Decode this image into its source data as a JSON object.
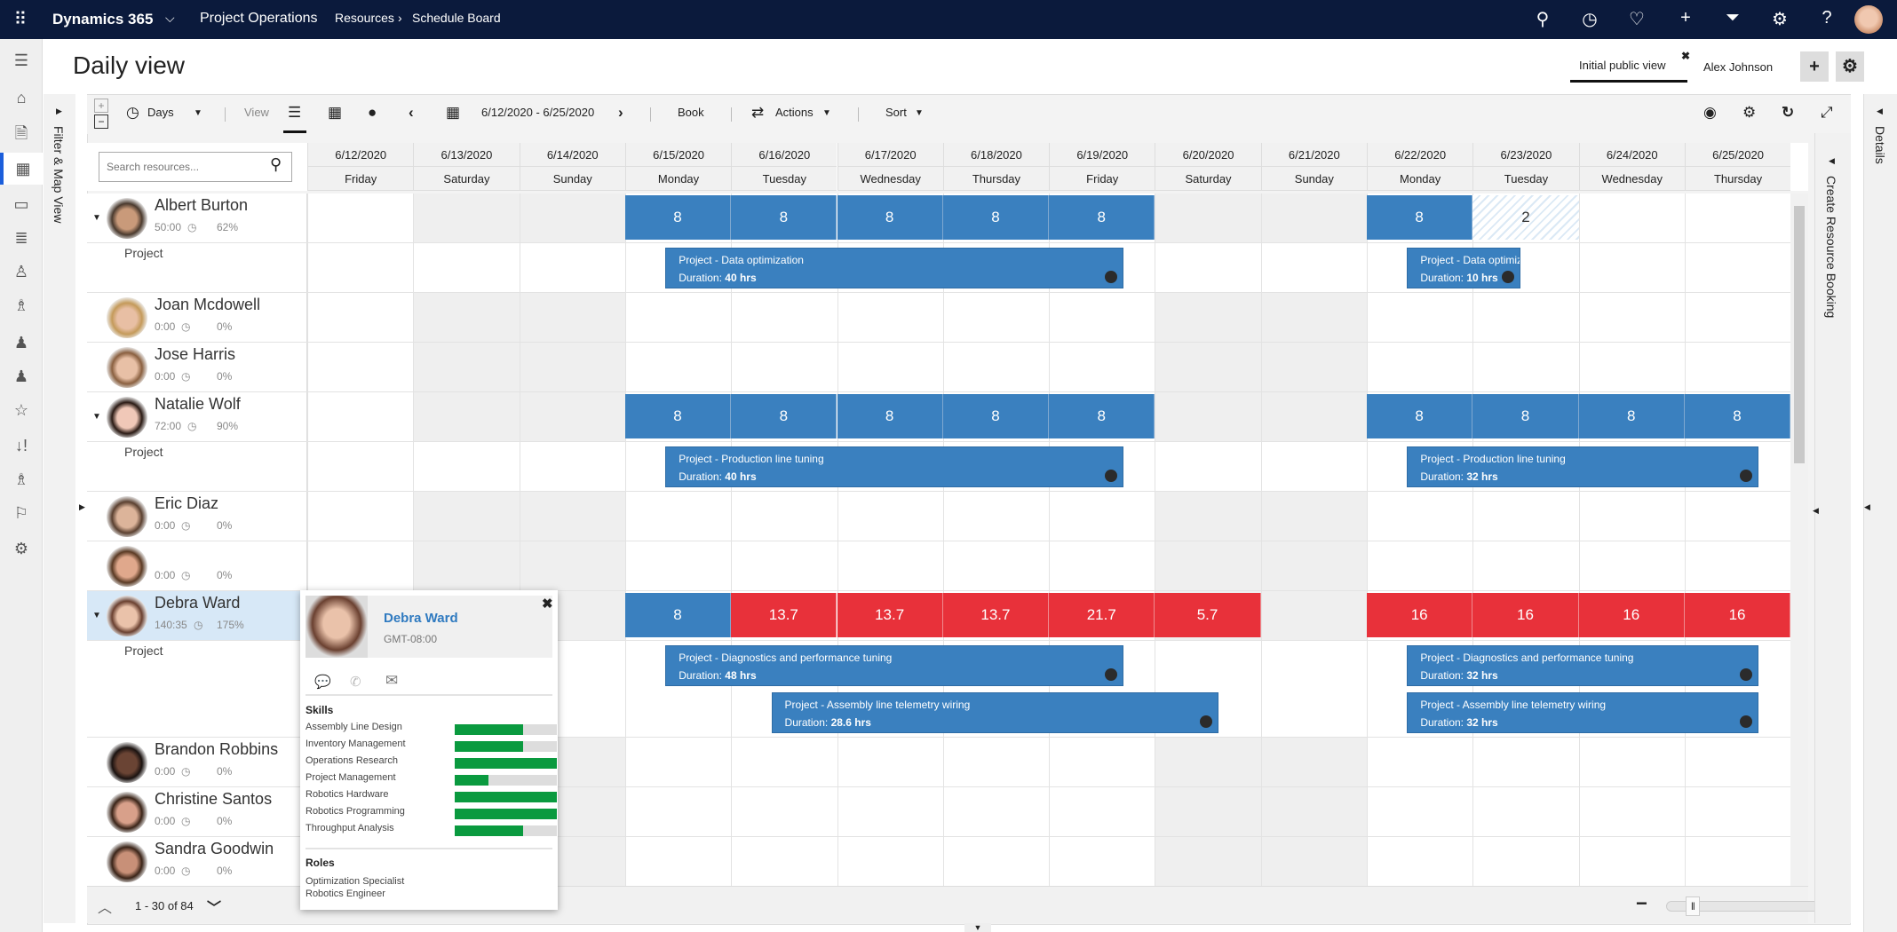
{
  "topbar": {
    "app": "Dynamics 365",
    "area": "Project Operations",
    "breadcrumb": [
      "Resources",
      "Schedule Board"
    ],
    "icons": [
      "search-icon",
      "task-icon",
      "lightbulb-icon",
      "plus-icon",
      "filter-icon",
      "settings-icon",
      "help-icon",
      "user-avatar"
    ]
  },
  "nav": {
    "items": [
      "menu",
      "home",
      "resource-requests",
      "schedule-board",
      "resource-reservations",
      "resource-list",
      "roles",
      "resource-groups",
      "bookable-resources",
      "bookings",
      "favorites",
      "priorities",
      "teams",
      "flags",
      "settings"
    ],
    "active": "schedule-board"
  },
  "page": {
    "title": "Daily view",
    "tabs": [
      "Initial public view",
      "Alex Johnson"
    ],
    "active_tab": "Initial public view",
    "close": "✖",
    "add": "+",
    "gear": "⚙"
  },
  "filter_panel": {
    "label": "Filter & Map View"
  },
  "toolbar": {
    "days": "Days",
    "view": "View",
    "date_range": "6/12/2020 - 6/25/2020",
    "book": "Book",
    "actions": "Actions",
    "sort": "Sort"
  },
  "search": {
    "placeholder": "Search resources..."
  },
  "columns": [
    {
      "date": "6/12/2020",
      "day": "Friday",
      "weekend": false
    },
    {
      "date": "6/13/2020",
      "day": "Saturday",
      "weekend": true
    },
    {
      "date": "6/14/2020",
      "day": "Sunday",
      "weekend": true
    },
    {
      "date": "6/15/2020",
      "day": "Monday",
      "weekend": false
    },
    {
      "date": "6/16/2020",
      "day": "Tuesday",
      "weekend": false
    },
    {
      "date": "6/17/2020",
      "day": "Wednesday",
      "weekend": false
    },
    {
      "date": "6/18/2020",
      "day": "Thursday",
      "weekend": false
    },
    {
      "date": "6/19/2020",
      "day": "Friday",
      "weekend": false
    },
    {
      "date": "6/20/2020",
      "day": "Saturday",
      "weekend": true
    },
    {
      "date": "6/21/2020",
      "day": "Sunday",
      "weekend": true
    },
    {
      "date": "6/22/2020",
      "day": "Monday",
      "weekend": false
    },
    {
      "date": "6/23/2020",
      "day": "Tuesday",
      "weekend": false
    },
    {
      "date": "6/24/2020",
      "day": "Wednesday",
      "weekend": false
    },
    {
      "date": "6/25/2020",
      "day": "Thursday",
      "weekend": false
    }
  ],
  "resources": [
    {
      "name": "Albert Burton",
      "hours": "50:00",
      "pct": "62%",
      "skin": "#c99a7a",
      "hair": "#4a3a2e",
      "expanded": true,
      "sub_label": "Project",
      "cells": [
        null,
        null,
        null,
        {
          "v": "8",
          "t": "blue"
        },
        {
          "v": "8",
          "t": "blue"
        },
        {
          "v": "8",
          "t": "blue"
        },
        {
          "v": "8",
          "t": "blue"
        },
        {
          "v": "8",
          "t": "blue"
        },
        null,
        null,
        {
          "v": "8",
          "t": "blue"
        },
        {
          "v": "2",
          "t": "hatch"
        },
        null,
        null
      ],
      "bookings": [
        {
          "title": "Project - Data optimization",
          "duration_label": "Duration:",
          "duration": "40 hrs"
        },
        {
          "title": "Project - Data optimization",
          "duration_label": "Duration:",
          "duration": "10 hrs"
        }
      ]
    },
    {
      "name": "Joan Mcdowell",
      "hours": "0:00",
      "pct": "0%",
      "skin": "#e8bfa4",
      "hair": "#c49a5a"
    },
    {
      "name": "Jose Harris",
      "hours": "0:00",
      "pct": "0%",
      "skin": "#e8c0a6",
      "hair": "#8a6040"
    },
    {
      "name": "Natalie Wolf",
      "hours": "72:00",
      "pct": "90%",
      "skin": "#f0c8b8",
      "hair": "#2a1a14",
      "expanded": true,
      "sub_label": "Project",
      "cells": [
        null,
        null,
        null,
        {
          "v": "8",
          "t": "blue"
        },
        {
          "v": "8",
          "t": "blue"
        },
        {
          "v": "8",
          "t": "blue"
        },
        {
          "v": "8",
          "t": "blue"
        },
        {
          "v": "8",
          "t": "blue"
        },
        null,
        null,
        {
          "v": "8",
          "t": "blue"
        },
        {
          "v": "8",
          "t": "blue"
        },
        {
          "v": "8",
          "t": "blue"
        },
        {
          "v": "8",
          "t": "blue"
        }
      ],
      "bookings": [
        {
          "title": "Project - Production line tuning",
          "duration_label": "Duration:",
          "duration": "40 hrs"
        },
        {
          "title": "Project - Production line tuning",
          "duration_label": "Duration:",
          "duration": "32 hrs"
        }
      ]
    },
    {
      "name": "Eric Diaz",
      "hours": "0:00",
      "pct": "0%",
      "skin": "#dcb49a",
      "hair": "#5a4030"
    },
    {
      "name": "",
      "hours": "0:00",
      "pct": "0%",
      "skin": "#e0a88c",
      "hair": "#5a3a24"
    },
    {
      "name": "Debra Ward",
      "hours": "140:35",
      "pct": "175%",
      "skin": "#eac2aa",
      "hair": "#6a4030",
      "expanded": true,
      "selected": true,
      "sub_label": "Project",
      "cells": [
        null,
        null,
        null,
        {
          "v": "8",
          "t": "blue"
        },
        {
          "v": "13.7",
          "t": "red"
        },
        {
          "v": "13.7",
          "t": "red"
        },
        {
          "v": "13.7",
          "t": "red"
        },
        {
          "v": "21.7",
          "t": "red"
        },
        {
          "v": "5.7",
          "t": "red"
        },
        null,
        {
          "v": "16",
          "t": "red"
        },
        {
          "v": "16",
          "t": "red"
        },
        {
          "v": "16",
          "t": "red"
        },
        {
          "v": "16",
          "t": "red"
        }
      ],
      "bookings": [
        {
          "title": "Project - Diagnostics and performance tuning",
          "duration_label": "Duration:",
          "duration": "48 hrs"
        },
        {
          "title": "Project - Diagnostics and performance tuning",
          "duration_label": "Duration:",
          "duration": "32 hrs"
        },
        {
          "title": "Project - Assembly line telemetry wiring",
          "duration_label": "Duration:",
          "duration": "28.6 hrs"
        },
        {
          "title": "Project - Assembly line telemetry wiring",
          "duration_label": "Duration:",
          "duration": "32 hrs"
        }
      ]
    },
    {
      "name": "Brandon Robbins",
      "hours": "0:00",
      "pct": "0%",
      "skin": "#6a4434",
      "hair": "#1a1210"
    },
    {
      "name": "Christine Santos",
      "hours": "0:00",
      "pct": "0%",
      "skin": "#d8a08a",
      "hair": "#3a2418"
    },
    {
      "name": "Sandra Goodwin",
      "hours": "0:00",
      "pct": "0%",
      "skin": "#c89078",
      "hair": "#3a2418"
    }
  ],
  "pager": {
    "range": "1 - 30 of 84"
  },
  "zoom": {
    "level": 0.12
  },
  "right_panels": {
    "create": "Create Resource Booking",
    "details": "Details"
  },
  "popup": {
    "name": "Debra Ward",
    "timezone": "GMT-08:00",
    "skills_title": "Skills",
    "skills": [
      {
        "name": "Assembly Line Design",
        "level": 0.67
      },
      {
        "name": "Inventory Management",
        "level": 0.67
      },
      {
        "name": "Operations Research",
        "level": 1
      },
      {
        "name": "Project Management",
        "level": 0.33
      },
      {
        "name": "Robotics Hardware",
        "level": 1
      },
      {
        "name": "Robotics Programming",
        "level": 1
      },
      {
        "name": "Throughput Analysis",
        "level": 0.67
      }
    ],
    "roles_title": "Roles",
    "roles": [
      "Optimization Specialist",
      "Robotics Engineer"
    ]
  },
  "colors": {
    "topbar": "#0b1a3c",
    "booked": "#3a80bf",
    "overbooked": "#e8313a",
    "skill": "#0a9a3f",
    "accent": "#1b5edb"
  }
}
